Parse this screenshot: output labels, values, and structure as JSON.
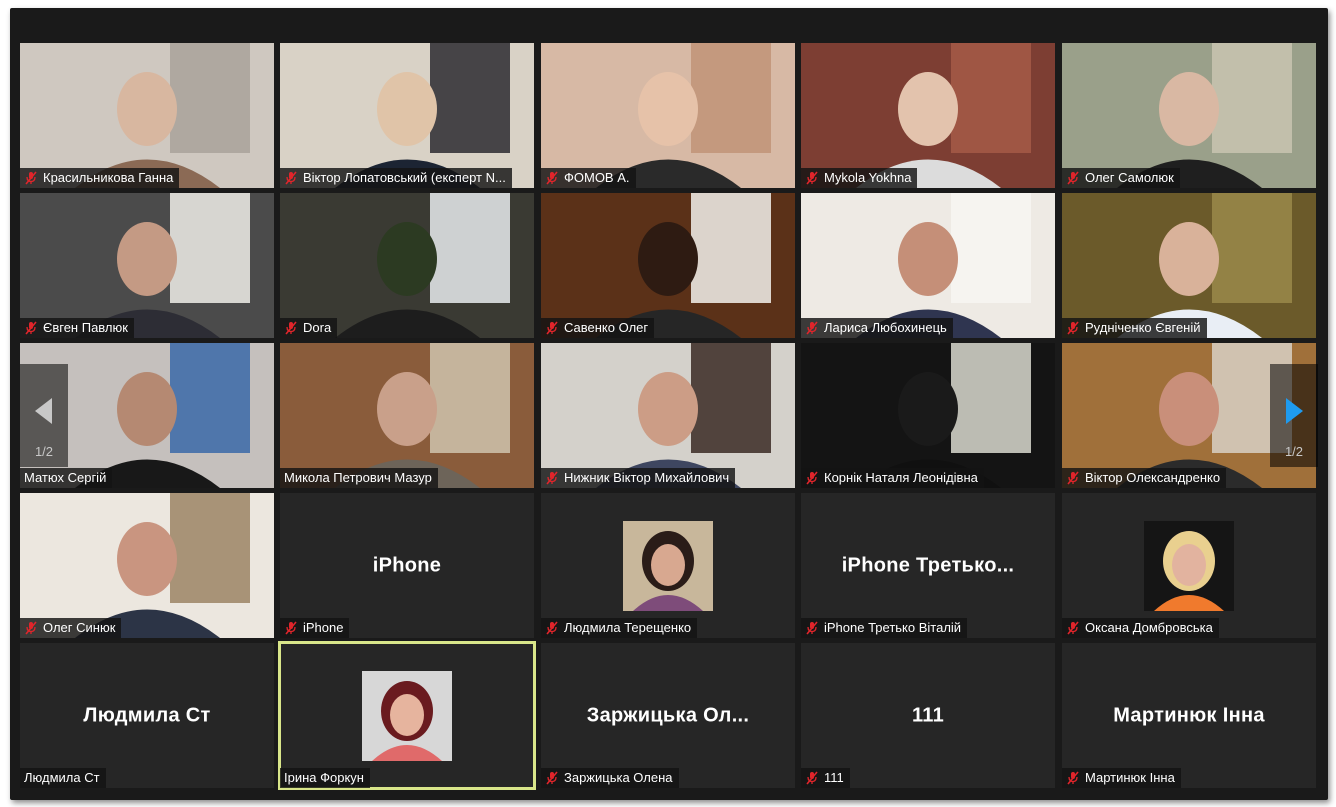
{
  "meeting": {
    "pagination": {
      "prev_page": "1/2",
      "next_page": "1/2"
    },
    "colors": {
      "background": "#1a1a1a",
      "tile": "#262626",
      "active_border": "#d9e68a",
      "muted_icon": "#e0252b",
      "next_arrow": "#1e9bf0"
    },
    "tiles": [
      {
        "label": "Красильникова Ганна",
        "muted": true,
        "video": "room-light"
      },
      {
        "label": "Віктор Лопатовський (експерт N...",
        "muted": true,
        "video": "room-tv"
      },
      {
        "label": "ФОМОВ А.",
        "muted": true,
        "video": "room-warm"
      },
      {
        "label": "Mykola Yokhna",
        "muted": true,
        "video": "room-red"
      },
      {
        "label": "Олег Самолюк",
        "muted": true,
        "video": "room-green"
      },
      {
        "label": "Євген Павлюк",
        "muted": true,
        "video": "room-window"
      },
      {
        "label": "Dora",
        "muted": true,
        "video": "room-plant"
      },
      {
        "label": "Савенко Олег",
        "muted": true,
        "video": "room-curtain"
      },
      {
        "label": "Лариса Любохинець",
        "muted": true,
        "video": "room-bright"
      },
      {
        "label": "Рудніченко Євгеній",
        "muted": true,
        "video": "room-yellow"
      },
      {
        "label": "Матюх Сергій",
        "muted": false,
        "video": "room-emblem"
      },
      {
        "label": "Микола Петрович Мазур",
        "muted": false,
        "video": "room-books"
      },
      {
        "label": "Нижник Віктор Михайлович",
        "muted": true,
        "video": "room-office"
      },
      {
        "label": "Корнік Наталя Леонідівна",
        "muted": true,
        "video": "room-dark"
      },
      {
        "label": "Віктор Олександренко",
        "muted": true,
        "video": "room-door"
      },
      {
        "label": "Олег Синюк",
        "muted": true,
        "video": "room-shelf"
      },
      {
        "label": "iPhone",
        "muted": true,
        "display_name": "iPhone"
      },
      {
        "label": "Людмила Терещенко",
        "muted": true,
        "avatar": "photo-brunette"
      },
      {
        "label": "iPhone Третько Віталій",
        "muted": true,
        "display_name": "iPhone Третько..."
      },
      {
        "label": "Оксана Домбровська",
        "muted": true,
        "avatar": "photo-blonde"
      },
      {
        "label": "Людмила Ст",
        "muted": false,
        "display_name": "Людмила Ст"
      },
      {
        "label": "Ірина Форкун",
        "muted": false,
        "avatar": "photo-redhair",
        "active_speaker": true
      },
      {
        "label": "Заржицька Олена",
        "muted": true,
        "display_name": "Заржицька Ол..."
      },
      {
        "label": "111",
        "muted": true,
        "display_name": "111"
      },
      {
        "label": "Мартинюк Інна",
        "muted": true,
        "display_name": "Мартинюк Інна"
      }
    ]
  }
}
